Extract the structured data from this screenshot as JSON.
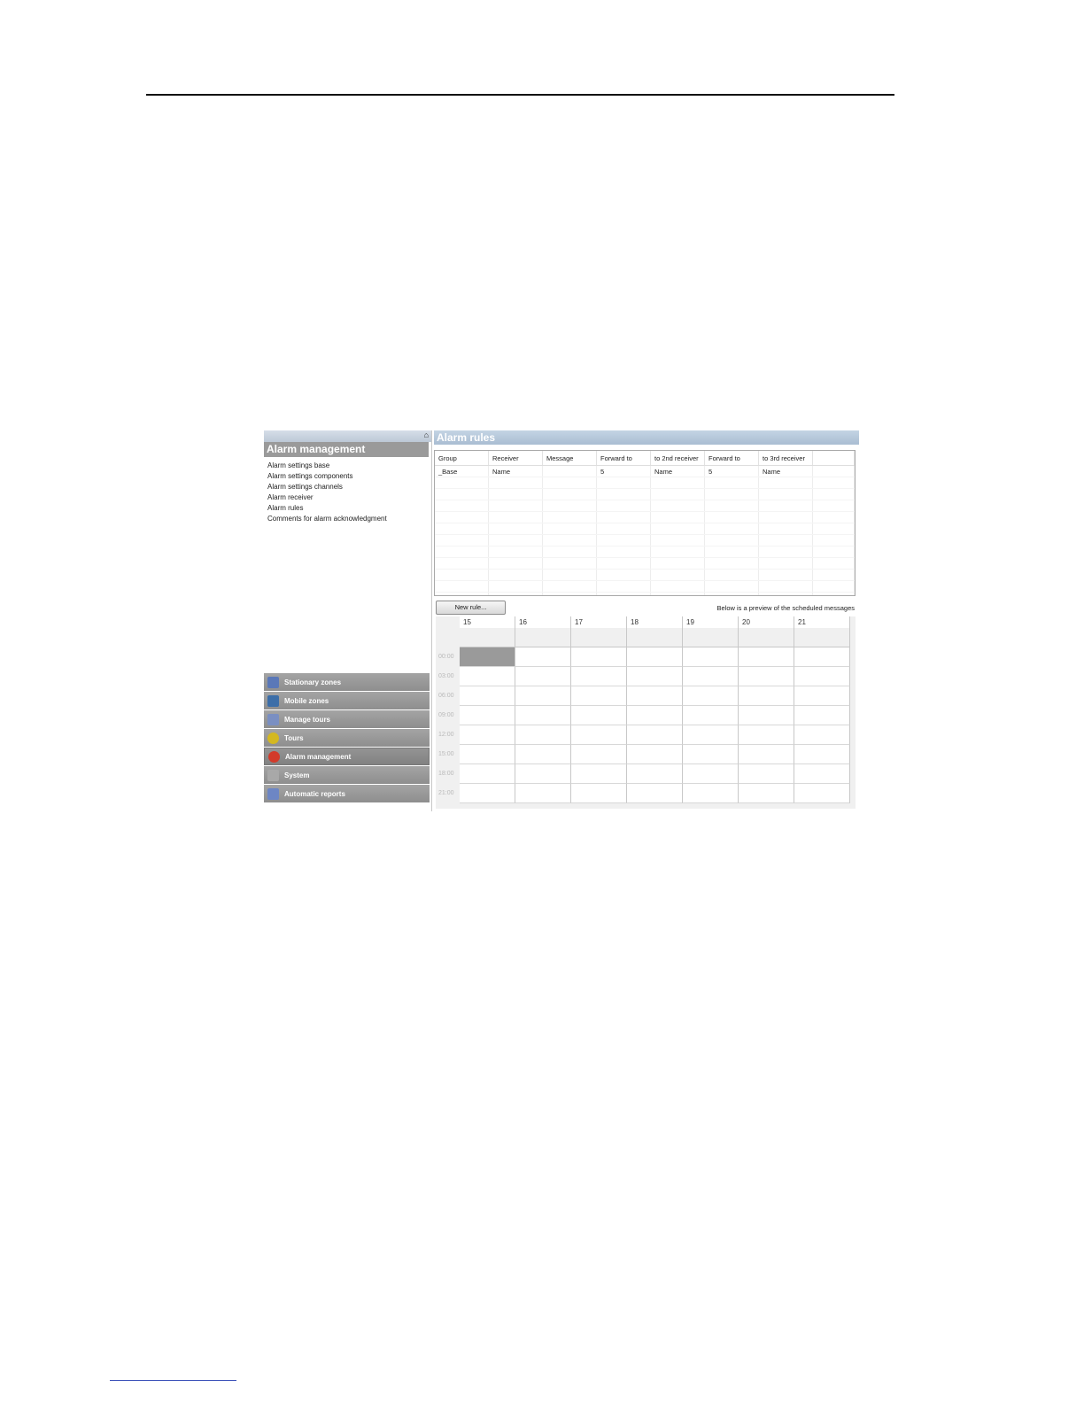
{
  "nav": {
    "title": "Alarm management",
    "links": [
      "Alarm settings base",
      "Alarm settings components",
      "Alarm settings channels",
      "Alarm receiver",
      "Alarm rules",
      "Comments for alarm acknowledgment"
    ],
    "sections": [
      {
        "label": "Stationary zones",
        "icon": "building-icon",
        "color": "#5a78b8"
      },
      {
        "label": "Mobile zones",
        "icon": "truck-icon",
        "color": "#3c6ea8"
      },
      {
        "label": "Manage tours",
        "icon": "clipboard-icon",
        "color": "#7a8fc2"
      },
      {
        "label": "Tours",
        "icon": "star-icon",
        "color": "#d4b820"
      },
      {
        "label": "Alarm management",
        "icon": "alarm-icon",
        "color": "#d23a2a",
        "active": true
      },
      {
        "label": "System",
        "icon": "wrench-icon",
        "color": "#a8a8a8"
      },
      {
        "label": "Automatic reports",
        "icon": "report-icon",
        "color": "#6d86c4"
      }
    ]
  },
  "content": {
    "title": "Alarm rules",
    "table": {
      "headers": [
        "Group",
        "Receiver",
        "Message",
        "Forward to",
        "to 2nd receiver",
        "Forward to",
        "to 3rd receiver",
        ""
      ],
      "rows": [
        [
          "_Base",
          "Name",
          "",
          "5",
          "Name",
          "5",
          "Name",
          ""
        ]
      ]
    },
    "new_rule_label": "New rule...",
    "preview_note": "Below is a preview of the scheduled messages",
    "schedule": {
      "days": [
        "15",
        "16",
        "17",
        "18",
        "19",
        "20",
        "21"
      ],
      "times": [
        "00:00",
        "03:00",
        "06:00",
        "09:00",
        "12:00",
        "15:00",
        "18:00",
        "21:00"
      ],
      "selected": {
        "day": "15",
        "time": "00:00"
      }
    }
  }
}
